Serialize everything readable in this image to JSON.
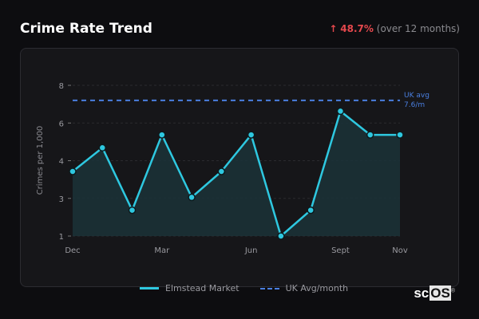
{
  "header": {
    "title": "Crime Rate Trend",
    "change_arrow": "↑",
    "change_value": "48.7%",
    "change_period": "(over 12 months)"
  },
  "chart_data": {
    "type": "line",
    "title": "Crime Rate Trend",
    "ylabel": "Crimes per 1,000",
    "xlabel": "",
    "ylim": [
      1,
      8
    ],
    "y_ticks": [
      {
        "value": 1,
        "label": "1"
      },
      {
        "value": 2.75,
        "label": "3"
      },
      {
        "value": 4.5,
        "label": "4"
      },
      {
        "value": 6.25,
        "label": "6"
      },
      {
        "value": 8,
        "label": "8"
      }
    ],
    "x_tick_labels": [
      {
        "index": 0,
        "label": "Dec"
      },
      {
        "index": 3,
        "label": "Mar"
      },
      {
        "index": 6,
        "label": "Jun"
      },
      {
        "index": 9,
        "label": "Sept"
      },
      {
        "index": 11,
        "label": "Nov"
      }
    ],
    "series": [
      {
        "name": "Elmstead Market",
        "color": "#2ec8e0",
        "values": [
          4.0,
          5.1,
          2.2,
          5.7,
          2.8,
          4.0,
          5.7,
          1.0,
          2.2,
          6.8,
          5.7,
          5.7
        ]
      }
    ],
    "reference": {
      "name": "UK Avg/month",
      "value": 7.3,
      "label_line1": "UK avg",
      "label_line2": "7.6/m",
      "color": "#4a7fe0"
    },
    "grid": true,
    "legend_position": "bottom"
  },
  "legend": {
    "series": "Elmstead Market",
    "reference": "UK Avg/month"
  },
  "logo": {
    "text_a": "sc",
    "text_b": "OS",
    "mark": "®"
  }
}
